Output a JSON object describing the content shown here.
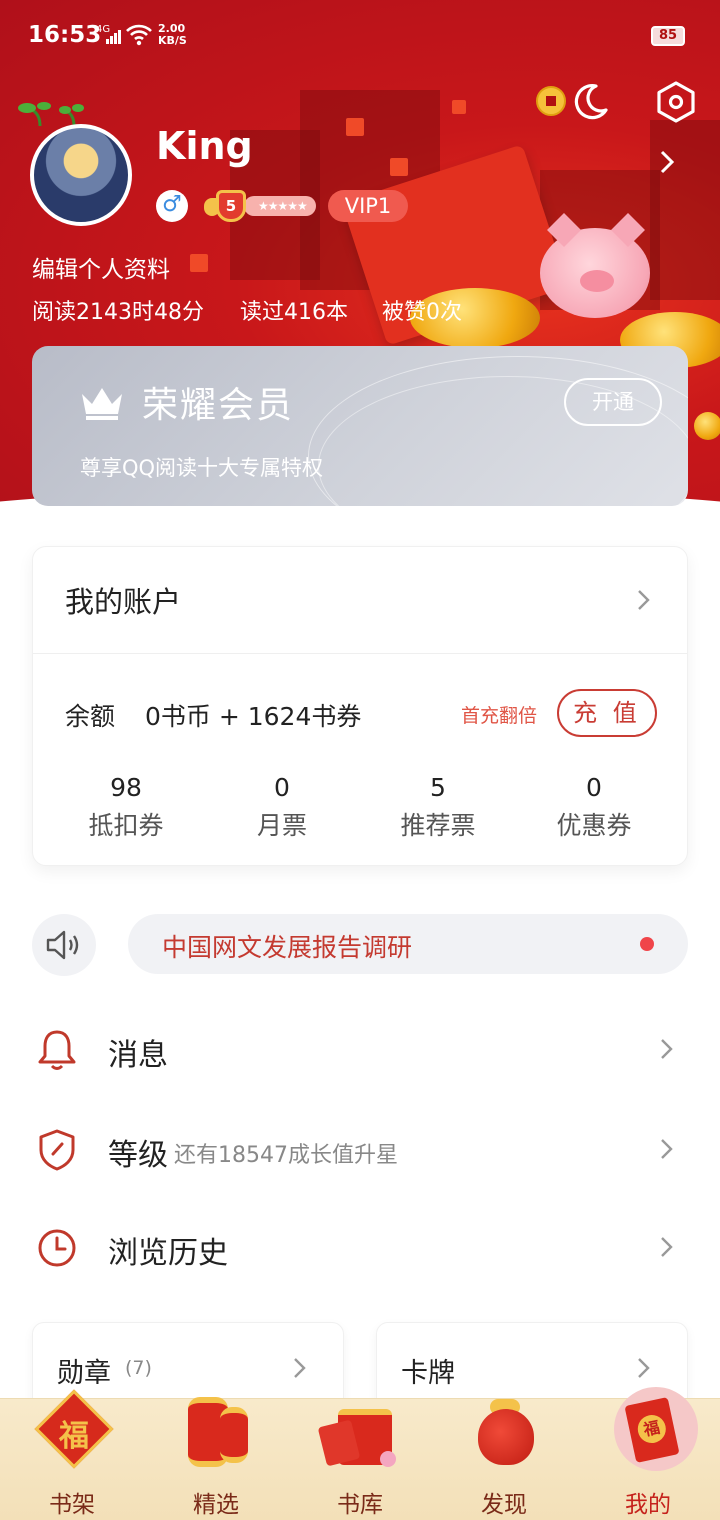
{
  "status_bar": {
    "time": "16:53",
    "network": "4G",
    "speed_top": "2.00",
    "speed_bottom": "KB/S",
    "battery": "85"
  },
  "profile": {
    "username": "King",
    "level": "5",
    "level_stars": "★★★★★",
    "vip_label": "VIP1",
    "gender_symbol": "♂",
    "edit_label": "编辑个人资料",
    "read_time": "阅读2143时48分",
    "books_read": "读过416本",
    "likes": "被赞0次"
  },
  "vip_card": {
    "title": "荣耀会员",
    "subtitle": "尊享QQ阅读十大专属特权",
    "button": "开通"
  },
  "account": {
    "title": "我的账户",
    "balance_label": "余额",
    "balance_value": "0书币 + 1624书券",
    "first_double": "首充翻倍",
    "recharge": "充 值",
    "tickets": [
      {
        "num": "98",
        "label": "抵扣券"
      },
      {
        "num": "0",
        "label": "月票"
      },
      {
        "num": "5",
        "label": "推荐票"
      },
      {
        "num": "0",
        "label": "优惠券"
      }
    ]
  },
  "notice": {
    "text": "中国网文发展报告调研"
  },
  "menu": [
    {
      "label": "消息",
      "sub": "",
      "icon": "bell-icon"
    },
    {
      "label": "等级",
      "sub": "还有18547成长值升星",
      "icon": "shield-icon"
    },
    {
      "label": "浏览历史",
      "sub": "",
      "icon": "clock-icon"
    }
  ],
  "cards": [
    {
      "title": "勋章",
      "count": "(7)"
    },
    {
      "title": "卡牌",
      "count": ""
    }
  ],
  "bottom_nav": [
    {
      "label": "书架",
      "icon": "fu-icon"
    },
    {
      "label": "精选",
      "icon": "lantern-icon"
    },
    {
      "label": "书库",
      "icon": "drum-icon"
    },
    {
      "label": "发现",
      "icon": "pouch-icon"
    },
    {
      "label": "我的",
      "icon": "red-packet-icon"
    }
  ],
  "colors": {
    "header_red": "#c8171a",
    "accent_red": "#c93c34",
    "nav_bg": "#f3e0b8",
    "nav_active": "#c5221c"
  }
}
